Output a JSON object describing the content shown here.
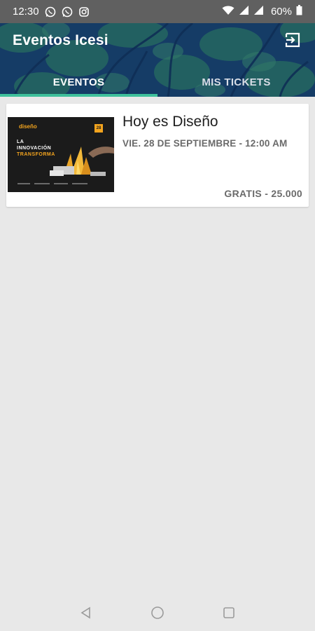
{
  "status_bar": {
    "time": "12:30",
    "battery": "60%",
    "icons": [
      "whatsapp-icon",
      "whatsapp-icon",
      "instagram-icon",
      "wifi-icon",
      "signal-icon",
      "signal-icon",
      "battery-icon"
    ]
  },
  "app": {
    "title": "Eventos Icesi",
    "tabs": [
      {
        "label": "EVENTOS",
        "active": true
      },
      {
        "label": "MIS TICKETS",
        "active": false
      }
    ],
    "accent_color": "#3fc19b"
  },
  "events": [
    {
      "title": "Hoy es Diseño",
      "date": "VIE. 28 DE SEPTIEMBRE - 12:00 AM",
      "price": "GRATIS - 25.000",
      "poster": {
        "brand": "diseño",
        "date_badge": "28",
        "line1": "LA",
        "line2": "INNOVACIÓN",
        "line3": "TRANSFORMA"
      }
    }
  ],
  "nav": {
    "icons": [
      "back-icon",
      "home-icon",
      "recents-icon"
    ]
  }
}
